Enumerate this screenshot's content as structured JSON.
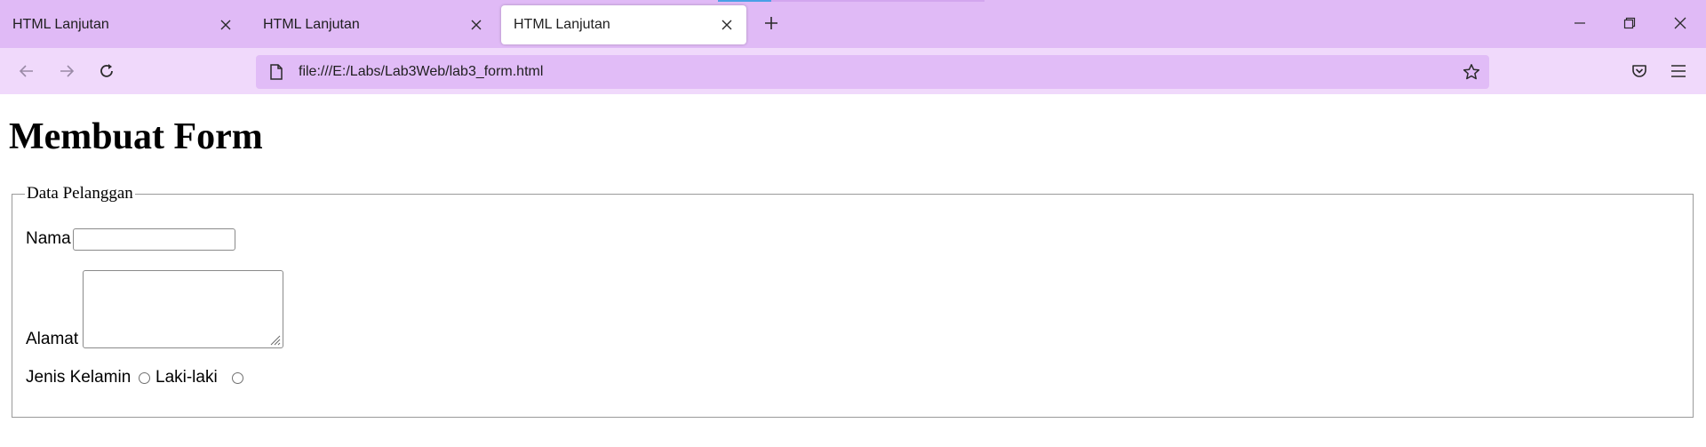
{
  "browser": {
    "tabs": [
      {
        "title": "HTML Lanjutan",
        "active": false
      },
      {
        "title": "HTML Lanjutan",
        "active": false
      },
      {
        "title": "HTML Lanjutan",
        "active": true
      }
    ],
    "url": "file:///E:/Labs/Lab3Web/lab3_form.html",
    "colors": {
      "tabstrip": "#e0baf6",
      "navbar": "#f0d9fb",
      "urlbar": "#e1bcf7"
    }
  },
  "page": {
    "heading": "Membuat Form",
    "fieldset_legend": "Data Pelanggan",
    "fields": {
      "nama_label": "Nama",
      "nama_value": "",
      "alamat_label": "Alamat",
      "alamat_value": "",
      "gender_label": "Jenis Kelamin",
      "gender_option_1": "Laki-laki",
      "gender_option_2": ""
    }
  }
}
